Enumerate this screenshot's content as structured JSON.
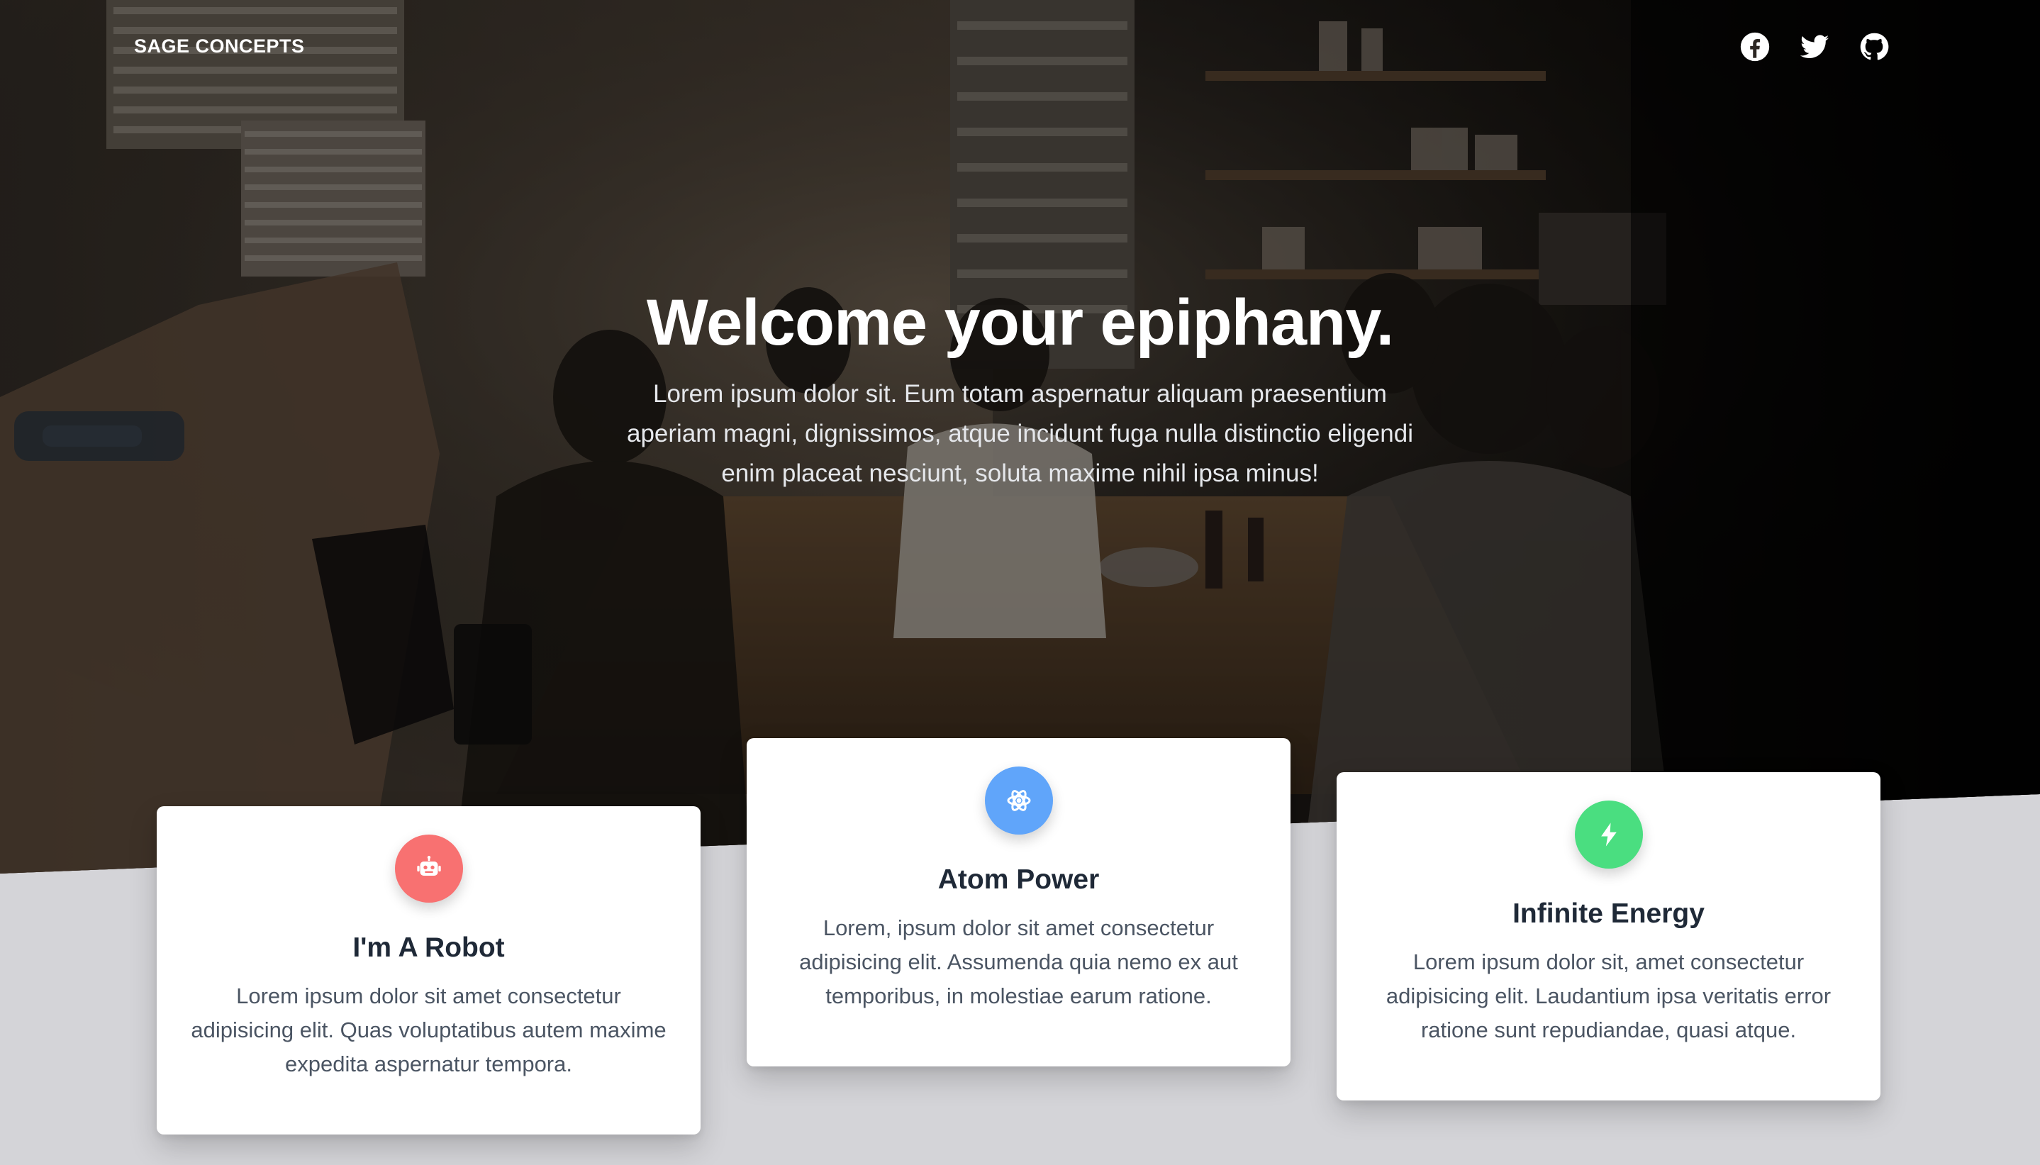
{
  "navbar": {
    "brand": "SAGE CONCEPTS",
    "social": [
      {
        "name": "facebook",
        "icon": "facebook-icon"
      },
      {
        "name": "twitter",
        "icon": "twitter-icon"
      },
      {
        "name": "github",
        "icon": "github-icon"
      }
    ]
  },
  "hero": {
    "title": "Welcome your epiphany.",
    "text": "Lorem ipsum dolor sit. Eum totam aspernatur aliquam praesentium aperiam magni, dignissimos, atque incidunt fuga nulla distinctio eligendi enim placeat nesciunt, soluta maxime nihil ipsa minus!"
  },
  "cards": [
    {
      "title": "I'm A Robot",
      "text": "Lorem ipsum dolor sit amet consectetur adipisicing elit. Quas voluptatibus autem maxime expedita aspernatur tempora.",
      "icon": "robot-icon",
      "color": "#f87171"
    },
    {
      "title": "Atom Power",
      "text": "Lorem, ipsum dolor sit amet consectetur adipisicing elit. Assumenda quia nemo ex aut temporibus, in molestiae earum ratione.",
      "icon": "atom-icon",
      "color": "#60a5fa"
    },
    {
      "title": "Infinite Energy",
      "text": "Lorem ipsum dolor sit, amet consectetur adipisicing elit. Laudantium ipsa veritatis error ratione sunt repudiandae, quasi atque.",
      "icon": "bolt-icon",
      "color": "#4ade80"
    }
  ],
  "colors": {
    "section_background": "#d4d4d8",
    "card_background": "#ffffff",
    "title_text": "#1f2937",
    "body_text": "#4b5563"
  }
}
